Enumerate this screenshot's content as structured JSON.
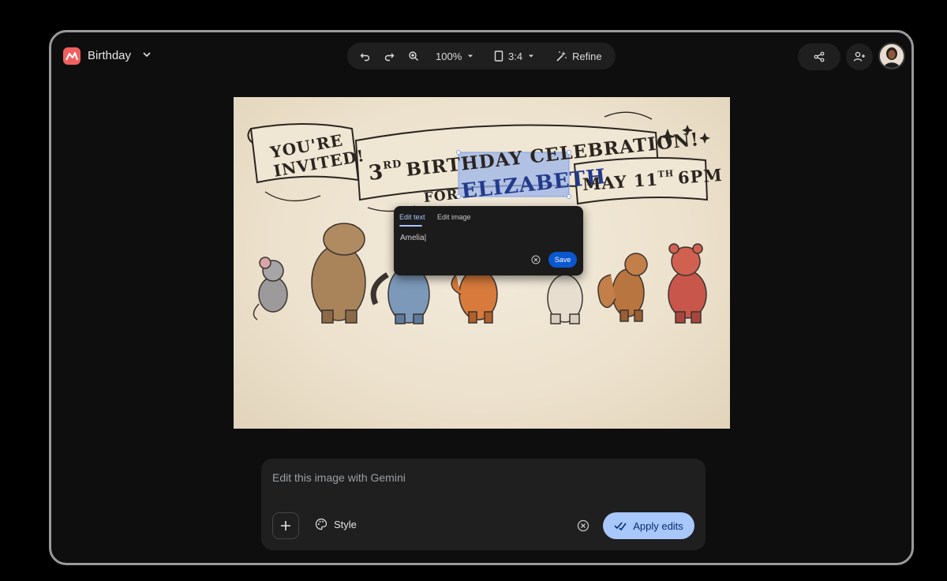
{
  "app": {
    "title": "Birthday"
  },
  "toolbar": {
    "zoom_label": "100%",
    "aspect_label": "3:4",
    "refine_label": "Refine"
  },
  "canvas": {
    "left_banner": [
      "YOU'RE",
      "INVITED!"
    ],
    "center_banner_line1_prefix": "3",
    "center_banner_line1_sup": "RD",
    "center_banner_line1_rest": "BIRTHDAY CELEBRATION!",
    "center_banner_line2_for": "FOR",
    "center_banner_line2_name": "ELIZABETH",
    "right_banner_day": "MAY 11",
    "right_banner_sup": "TH",
    "right_banner_time": "6PM"
  },
  "edit_popup": {
    "tab_edit_text": "Edit text",
    "tab_edit_image": "Edit image",
    "input_value": "Amelia|",
    "save_label": "Save"
  },
  "prompt": {
    "placeholder": "Edit this image with Gemini",
    "style_label": "Style",
    "apply_label": "Apply edits"
  },
  "colors": {
    "accent_light": "#a8c7fa",
    "accent_dark": "#0b57d0",
    "app_logo": "#f06060"
  }
}
